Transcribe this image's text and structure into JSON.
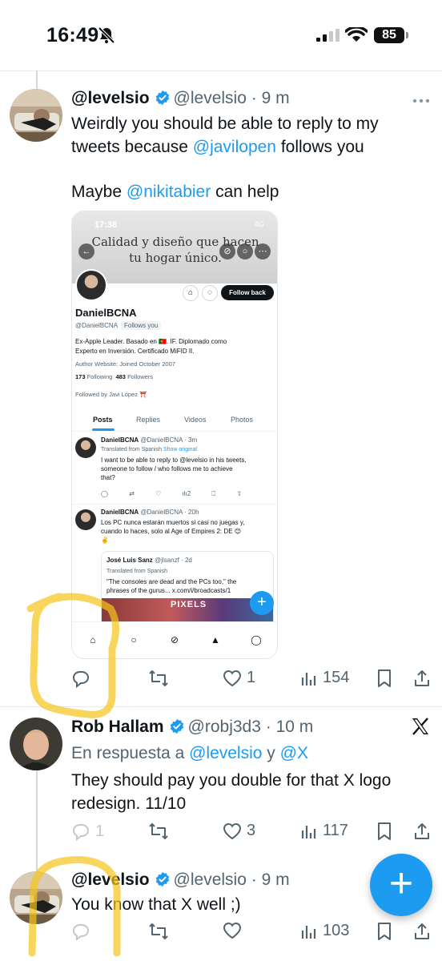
{
  "status_bar": {
    "time": "16:49",
    "battery": "85"
  },
  "tweet1": {
    "name": "@levelsio",
    "handle": "@levelsio",
    "sep": "·",
    "time": "9 m",
    "text_line1": "Weirdly you should be able to reply to my",
    "text_line2_a": "tweets because ",
    "text_line2_mention": "@javilopen",
    "text_line2_b": " follows you",
    "text_line3_a": "Maybe ",
    "text_line3_mention": "@nikitabier",
    "text_line3_b": " can help",
    "actions": {
      "replies": "",
      "retweets": "",
      "likes": "1",
      "views": "154"
    }
  },
  "embed": {
    "time": "17:38",
    "status": "4G",
    "banner_line1": "Calidad y diseño que hacen",
    "banner_line2": "tu hogar único.",
    "follow_back": "Follow back",
    "name": "DanielBCNA",
    "handle": "@DanielBCNA",
    "follows_you": "Follows you",
    "bio_line1": "Ex-Apple Leader. Basado en 🇵🇹. IF. Diplomado como",
    "bio_line2": "Experto en Inversión. Certificado MiFID II.",
    "meta": "Author   Website:   Joined October 2007",
    "following_count": "173",
    "following_label": "Following",
    "followers_count": "483",
    "followers_label": "Followers",
    "followed_by": "Followed by Javi López ⛩️",
    "tabs": [
      "Posts",
      "Replies",
      "Videos",
      "Photos"
    ],
    "post1": {
      "name": "DanielBCNA",
      "handle": "@DanielBCNA · 3m",
      "translated": "Translated from Spanish",
      "show_original": "Show original",
      "text_line1": "I want to be able to reply to @levelsio in his tweets,",
      "text_line2": "someone to follow / who follows me to achieve",
      "text_line3": "that?",
      "views": "2"
    },
    "post2": {
      "name": "DanielBCNA",
      "handle": "@DanielBCNA · 20h",
      "text_line1": "Los PC nunca estarán muertos si casi no juegas y,",
      "text_line2": "cuando lo haces, solo al Age of Empires 2: DE 😊",
      "text_line3": "✌️"
    },
    "quote": {
      "name": "José Luis Sanz",
      "handle": "@jlsanzf · 2d",
      "translated": "Translated from Spanish",
      "text_line1": "\"The consoles are dead and the PCs too,\" the",
      "text_line2": "phrases of the gurus... x.com/i/broadcasts/1",
      "image_label": "PIXELS"
    }
  },
  "tweet2": {
    "name": "Rob Hallam",
    "handle": "@robj3d3",
    "sep": "·",
    "time": "10 m",
    "reply_prefix": "En respuesta a ",
    "reply_mention1": "@levelsio",
    "reply_and": " y ",
    "reply_mention2": "@X",
    "text_line1": "They should pay you double for that X logo",
    "text_line2": "redesign. 11/10",
    "actions": {
      "replies": "1",
      "retweets": "",
      "likes": "3",
      "views": "117"
    }
  },
  "tweet3": {
    "name": "@levelsio",
    "handle": "@levelsio",
    "sep": "·",
    "time": "9 m",
    "text": "You know that X well ;)",
    "actions": {
      "views": "103"
    }
  },
  "colors": {
    "accent": "#1d9bf0",
    "text": "#0f1419",
    "muted": "#536471",
    "highlighter": "#f5c518"
  }
}
